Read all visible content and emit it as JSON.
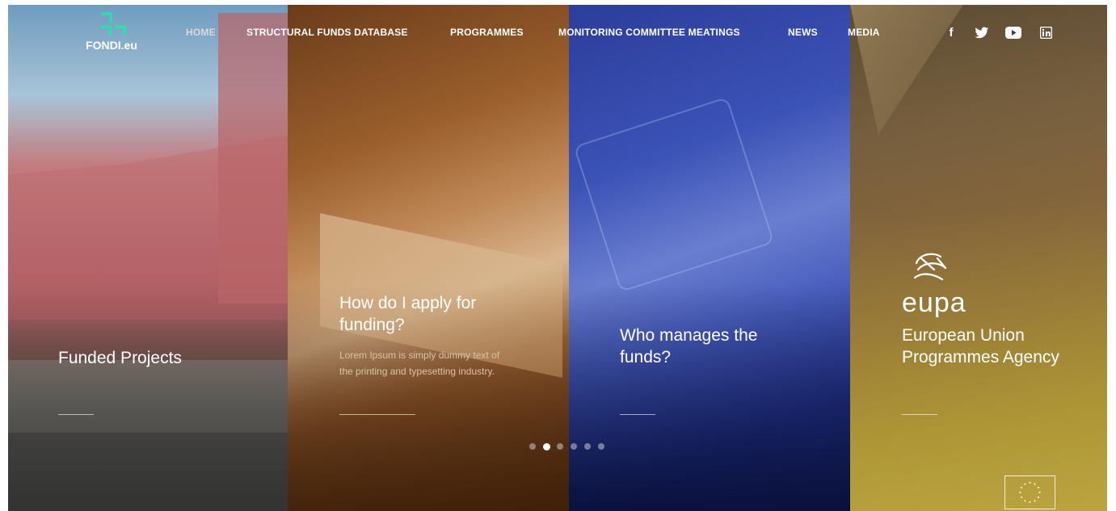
{
  "brand": {
    "name": "FONDI.eu",
    "accent": "#2fe0a6"
  },
  "nav": {
    "items": [
      {
        "label": "HOME",
        "active": true
      },
      {
        "label": "STRUCTURAL FUNDS DATABASE"
      },
      {
        "label": "PROGRAMMES"
      },
      {
        "label": "MONITORING COMMITTEE MEATINGS"
      },
      {
        "label": "NEWS"
      },
      {
        "label": "MEDIA"
      }
    ]
  },
  "social": [
    {
      "icon": "facebook-icon",
      "glyph": "f"
    },
    {
      "icon": "twitter-icon",
      "glyph": "🐦"
    },
    {
      "icon": "youtube-icon",
      "glyph": "▶"
    },
    {
      "icon": "linkedin-icon",
      "glyph": "in"
    }
  ],
  "panels": [
    {
      "title": "Funded Projects",
      "color": "#b96a6c"
    },
    {
      "title": "How do I apply for funding?",
      "body": "Lorem Ipsum is simply dummy text of the printing and typesetting industry.",
      "color": "#8a5428"
    },
    {
      "title": "Who manages the funds?",
      "color": "#3446a8"
    },
    {
      "logo_word": "eupa",
      "title": "European Union Programmes Agency",
      "color": "#b0983e"
    }
  ],
  "carousel": {
    "dots": 6,
    "active_index": 1
  }
}
